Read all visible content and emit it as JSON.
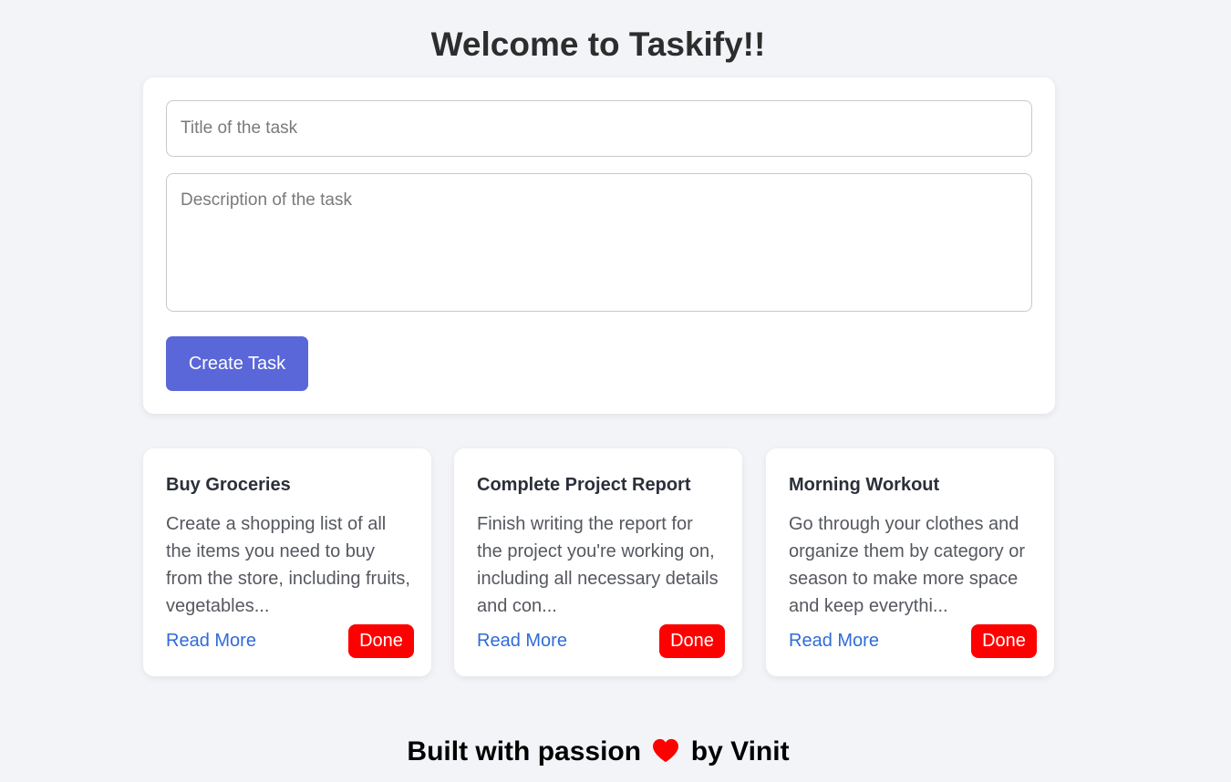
{
  "app": {
    "heading": "Welcome to Taskify!!"
  },
  "form": {
    "title_placeholder": "Title of the task",
    "title_value": "",
    "description_placeholder": "Description of the task",
    "description_value": "",
    "create_label": "Create Task",
    "create_color": "#5a67d8"
  },
  "tasks": [
    {
      "title": "Buy Groceries",
      "description": "Create a shopping list of all the items you need to buy from the store, including fruits, vegetables...",
      "read_more": "Read More",
      "done": "Done"
    },
    {
      "title": "Complete Project Report",
      "description": "Finish writing the report for the project you're working on, including all necessary details and con...",
      "read_more": "Read More",
      "done": "Done"
    },
    {
      "title": "Morning Workout",
      "description": "Go through your clothes and organize them by category or season to make more space and keep everythi...",
      "read_more": "Read More",
      "done": "Done"
    }
  ],
  "colors": {
    "done_button": "#ff0000",
    "link": "#2f6bd8",
    "background": "#f3f4f8"
  },
  "footer": {
    "prefix": "Built with passion",
    "icon": "heart-icon",
    "suffix": "by Vinit"
  }
}
